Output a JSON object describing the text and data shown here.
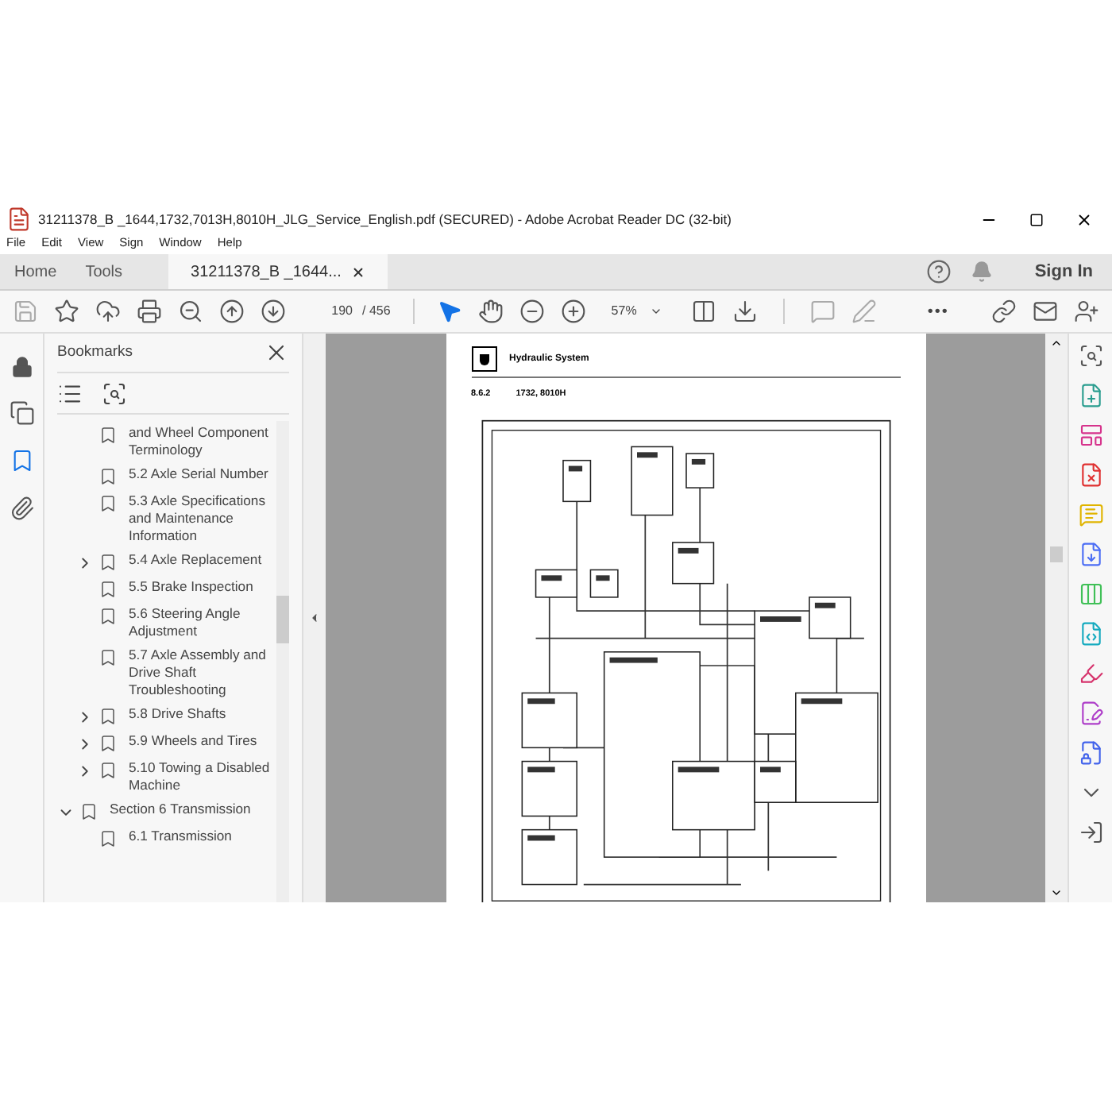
{
  "window": {
    "title": "31211378_B _1644,1732,7013H,8010H_JLG_Service_English.pdf (SECURED) - Adobe Acrobat Reader DC (32-bit)"
  },
  "menu": [
    "File",
    "Edit",
    "View",
    "Sign",
    "Window",
    "Help"
  ],
  "tabs": [
    {
      "label": "Home",
      "selected": false,
      "closable": false
    },
    {
      "label": "Tools",
      "selected": false,
      "closable": false
    },
    {
      "label": "31211378_B _1644...",
      "selected": true,
      "closable": true
    }
  ],
  "sign_in": "Sign In",
  "toolbar": {
    "page": "190",
    "page_count": "/ 456",
    "zoom": "57%",
    "more": "•••"
  },
  "bookmarks": {
    "title": "Bookmarks",
    "items": [
      {
        "children": [
          {
            "label": "and Wheel Component Terminology",
            "kind": "leaf"
          },
          {
            "label": "5.2 Axle Serial Number",
            "kind": "leaf"
          },
          {
            "label": "5.3 Axle Specifications and Maintenance Information",
            "kind": "leaf"
          },
          {
            "label": "5.4 Axle Replacement",
            "kind": "folder",
            "expanded": false
          },
          {
            "label": "5.5 Brake Inspection",
            "kind": "leaf"
          },
          {
            "label": "5.6 Steering Angle Adjustment",
            "kind": "leaf"
          },
          {
            "label": "5.7 Axle Assembly and Drive Shaft Troubleshooting",
            "kind": "leaf"
          },
          {
            "label": "5.8 Drive Shafts",
            "kind": "folder",
            "expanded": false
          },
          {
            "label": "5.9 Wheels and Tires",
            "kind": "folder",
            "expanded": false
          },
          {
            "label": "5.10 Towing a Disabled Machine",
            "kind": "folder",
            "expanded": false
          }
        ]
      },
      {
        "label": "Section 6 Transmission",
        "kind": "folder",
        "expanded": true,
        "children": [
          {
            "label": "6.1 Transmission",
            "kind": "leaf"
          }
        ]
      }
    ]
  },
  "document": {
    "header": "Hydraulic System",
    "section": "8.6.2",
    "models": "1732, 8010H"
  }
}
